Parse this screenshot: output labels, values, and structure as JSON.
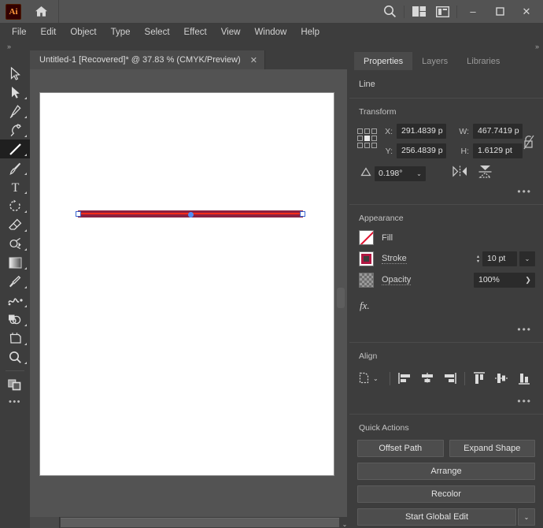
{
  "titlebar": {
    "app_badge": "Ai",
    "home_icon": "home-icon",
    "search_icon": "search-icon",
    "arrange_documents_icon": "arrange-documents-icon",
    "workspace_switcher_icon": "workspace-switcher-icon",
    "minimize_label": "–",
    "maximize_label": "❑",
    "close_label": "✕"
  },
  "menubar": {
    "items": [
      {
        "label": "File"
      },
      {
        "label": "Edit"
      },
      {
        "label": "Object"
      },
      {
        "label": "Type"
      },
      {
        "label": "Select"
      },
      {
        "label": "Effect"
      },
      {
        "label": "View"
      },
      {
        "label": "Window"
      },
      {
        "label": "Help"
      }
    ]
  },
  "subbar": {
    "collapse_left": "»",
    "collapse_right": "»"
  },
  "document_tab": {
    "title": "Untitled-1 [Recovered]* @ 37.83 % (CMYK/Preview)",
    "close_label": "✕"
  },
  "toolbar": {
    "more_tools_label": "•••",
    "tools": [
      {
        "name": "selection-tool",
        "selected": false
      },
      {
        "name": "direct-selection-tool",
        "selected": false
      },
      {
        "name": "pen-tool",
        "selected": false
      },
      {
        "name": "curvature-tool",
        "selected": false
      },
      {
        "name": "line-segment-tool",
        "selected": true
      },
      {
        "name": "paintbrush-tool",
        "selected": false
      },
      {
        "name": "type-tool",
        "selected": false
      },
      {
        "name": "rotate-tool",
        "selected": false
      },
      {
        "name": "eraser-tool",
        "selected": false
      },
      {
        "name": "scale-tool",
        "selected": false
      },
      {
        "name": "gradient-tool",
        "selected": false
      },
      {
        "name": "eyedropper-tool",
        "selected": false
      },
      {
        "name": "blend-tool",
        "selected": false
      },
      {
        "name": "shape-builder-tool",
        "selected": false
      },
      {
        "name": "artboard-tool",
        "selected": false
      },
      {
        "name": "zoom-tool",
        "selected": false
      },
      {
        "name": "fill-stroke-indicator",
        "selected": false
      }
    ]
  },
  "canvas": {
    "artwork_name": "selected-line-path",
    "stroke_color": "#8b2242",
    "selection_path_color": "#ff2d1a",
    "anchor_fill": "#ffffff",
    "anchor_border": "#3a66d1",
    "center_point_color": "#4f8ff7",
    "scroll_chevron": "⌄"
  },
  "properties": {
    "tabs": [
      {
        "label": "Properties",
        "active": true
      },
      {
        "label": "Layers",
        "active": false
      },
      {
        "label": "Libraries",
        "active": false
      }
    ],
    "object_type": "Line",
    "transform": {
      "title": "Transform",
      "x_label": "X:",
      "x_value": "291.4839 p",
      "y_label": "Y:",
      "y_value": "256.4839 p",
      "w_label": "W:",
      "w_value": "467.7419 p",
      "h_label": "H:",
      "h_value": "1.6129 pt",
      "angle_value": "0.198°",
      "angle_caret": "⌄",
      "constrain_icon": "link-broken-icon",
      "reference_point_icon": "reference-point-grid-icon",
      "flip_horizontal_icon": "flip-horizontal-icon",
      "flip_vertical_icon": "flip-vertical-icon",
      "more_options": "•••"
    },
    "appearance": {
      "title": "Appearance",
      "fill_label": "Fill",
      "fill_swatch": "none-swatch-icon",
      "stroke_label": "Stroke",
      "stroke_swatch_color": "#b01842",
      "stroke_weight": "10 pt",
      "stroke_caret": "⌄",
      "opacity_label": "Opacity",
      "opacity_value": "100%",
      "opacity_arrow": "❯",
      "fx_label": "fx.",
      "more_options": "•••"
    },
    "align": {
      "title": "Align",
      "target_caret": "⌄",
      "buttons": [
        {
          "name": "align-to-selection-dropdown"
        },
        {
          "name": "align-left-icon"
        },
        {
          "name": "align-horizontal-center-icon"
        },
        {
          "name": "align-right-icon"
        },
        {
          "name": "align-top-icon"
        },
        {
          "name": "align-vertical-center-icon"
        },
        {
          "name": "align-bottom-icon"
        }
      ],
      "more_options": "•••"
    },
    "quick_actions": {
      "title": "Quick Actions",
      "offset_path": "Offset Path",
      "expand_shape": "Expand Shape",
      "arrange": "Arrange",
      "recolor": "Recolor",
      "start_global_edit": "Start Global Edit",
      "global_edit_caret": "⌄"
    }
  }
}
